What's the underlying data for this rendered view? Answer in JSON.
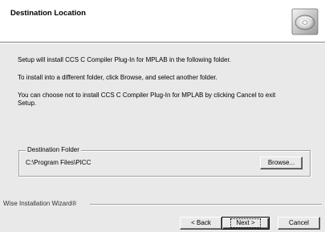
{
  "header": {
    "title": "Destination Location",
    "icon": "installer-disc-icon"
  },
  "body": {
    "paragraph1": "Setup will install CCS C Compiler Plug-In for MPLAB in the following folder.",
    "paragraph2": "To install into a different folder, click Browse, and select another folder.",
    "paragraph3_line1": "You can choose not to install CCS C Compiler Plug-In for MPLAB by clicking Cancel to exit",
    "paragraph3_line2": "Setup."
  },
  "destination": {
    "legend": "Destination Folder",
    "path": "C:\\Program Files\\PICC",
    "browse_label": "Browse..."
  },
  "footer": {
    "wizard_label": "Wise Installation Wizard®",
    "back_label": "< Back",
    "next_label": "Next >",
    "cancel_label": "Cancel"
  }
}
